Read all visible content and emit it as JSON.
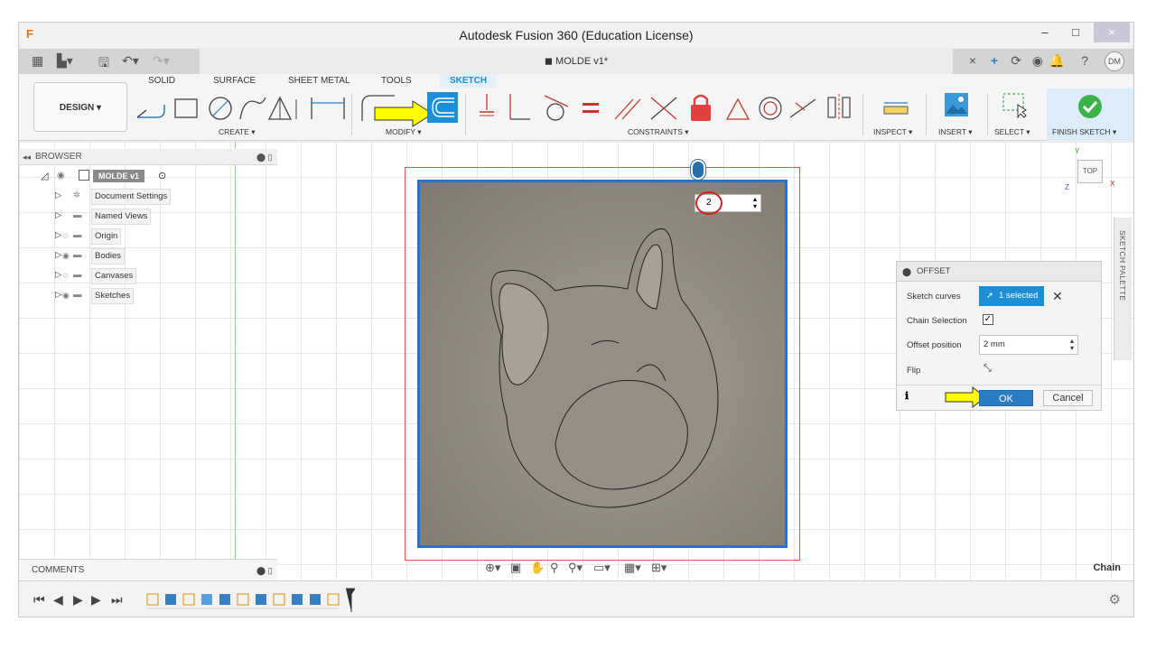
{
  "window": {
    "title": "Autodesk Fusion 360 (Education License)",
    "controls": {
      "minimize": "–",
      "maximize": "□",
      "close": "×"
    }
  },
  "tabbar": {
    "document_title": "MOLDE v1*",
    "user_initials": "DM"
  },
  "ribbon": {
    "workspace_button": "DESIGN ▾",
    "tabs": [
      {
        "label": "SOLID"
      },
      {
        "label": "SURFACE"
      },
      {
        "label": "SHEET METAL"
      },
      {
        "label": "TOOLS"
      },
      {
        "label": "SKETCH",
        "active": true
      }
    ],
    "groups": {
      "create": "CREATE ▾",
      "modify": "MODIFY ▾",
      "constraints": "CONSTRAINTS ▾",
      "inspect": "INSPECT ▾",
      "insert": "INSERT ▾",
      "select": "SELECT ▾",
      "finish": "FINISH SKETCH ▾"
    }
  },
  "browser": {
    "header": "BROWSER",
    "root": "MOLDE v1",
    "items": [
      {
        "label": "Document Settings",
        "icon": "gear-icon"
      },
      {
        "label": "Named Views",
        "icon": "folder-icon"
      },
      {
        "label": "Origin",
        "icon": "folder-icon"
      },
      {
        "label": "Bodies",
        "icon": "folder-icon"
      },
      {
        "label": "Canvases",
        "icon": "folder-icon"
      },
      {
        "label": "Sketches",
        "icon": "folder-icon"
      }
    ]
  },
  "canvas": {
    "offset_value": "2"
  },
  "offset_panel": {
    "title": "OFFSET",
    "sketch_curves_label": "Sketch curves",
    "sketch_curves_value": "1 selected",
    "chain_selection_label": "Chain Selection",
    "chain_selection_checked": true,
    "offset_position_label": "Offset position",
    "offset_position_value": "2 mm",
    "flip_label": "Flip",
    "ok": "OK",
    "cancel": "Cancel"
  },
  "sketch_palette": {
    "label": "SKETCH PALETTE"
  },
  "view_cube": {
    "face": "TOP"
  },
  "comments": {
    "label": "COMMENTS"
  },
  "status": {
    "right_text": "Chain"
  },
  "colors": {
    "accent": "#1d8fd6",
    "highlight_arrow": "#ffff00",
    "sketch_fill": "#8f8a7f",
    "selection_blue": "#1f74d6",
    "boundary_red": "#e05050"
  }
}
